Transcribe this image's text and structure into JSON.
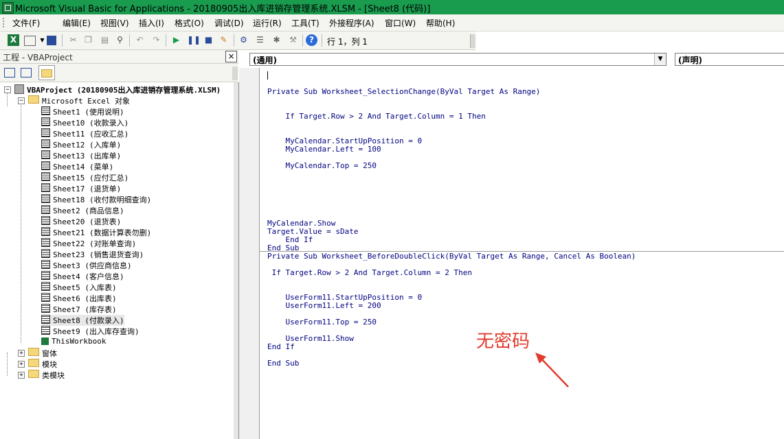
{
  "window": {
    "title": "Microsoft Visual Basic for Applications - 20180905出入库进销存管理系统.XLSM - [Sheet8 (代码)]"
  },
  "menu": [
    "文件(F)",
    "编辑(E)",
    "视图(V)",
    "插入(I)",
    "格式(O)",
    "调试(D)",
    "运行(R)",
    "工具(T)",
    "外接程序(A)",
    "窗口(W)",
    "帮助(H)"
  ],
  "toolbar": {
    "cursor_position": "行 1，列 1"
  },
  "project": {
    "title": "工程 - VBAProject",
    "close": "×",
    "root": "VBAProject (20180905出入库进销存管理系统.XLSM)",
    "excel_objects": "Microsoft Excel 对象",
    "sheets": [
      "Sheet1 (使用说明)",
      "Sheet10 (收款录入)",
      "Sheet11 (应收汇总)",
      "Sheet12 (入库单)",
      "Sheet13 (出库单)",
      "Sheet14 (菜单)",
      "Sheet15 (应付汇总)",
      "Sheet17 (退货单)",
      "Sheet18 (收付款明细查询)",
      "Sheet2 (商品信息)",
      "Sheet20 (退货表)",
      "Sheet21 (数据计算表勿删)",
      "Sheet22 (对账单查询)",
      "Sheet23 (销售退货查询)",
      "Sheet3 (供应商信息)",
      "Sheet4 (客户信息)",
      "Sheet5 (入库表)",
      "Sheet6 (出库表)",
      "Sheet7 (库存表)",
      "Sheet8 (付款录入)",
      "Sheet9 (出入库存查询)"
    ],
    "workbook": "ThisWorkbook",
    "folders": [
      "窗体",
      "模块",
      "类模块"
    ]
  },
  "code": {
    "object_combo": "(通用)",
    "proc_combo": "(声明)",
    "lines": [
      "Private Sub Worksheet_SelectionChange(ByVal Target As Range)",
      "    If Target.Row > 2 And Target.Column = 1 Then",
      "    MyCalendar.StartUpPosition = 0",
      "    MyCalendar.Left = 100",
      "    MyCalendar.Top = 250",
      "MyCalendar.Show",
      "Target.Value = sDate",
      "    End If",
      "End Sub",
      "Private Sub Worksheet_BeforeDoubleClick(ByVal Target As Range, Cancel As Boolean)",
      " If Target.Row > 2 And Target.Column = 2 Then",
      "    UserForm11.StartUpPosition = 0",
      "    UserForm11.Left = 200",
      "    UserForm11.Top = 250",
      "    UserForm11.Show",
      "End If",
      "End Sub"
    ]
  },
  "annotation": {
    "text": "无密码",
    "color": "#e23b2e"
  }
}
